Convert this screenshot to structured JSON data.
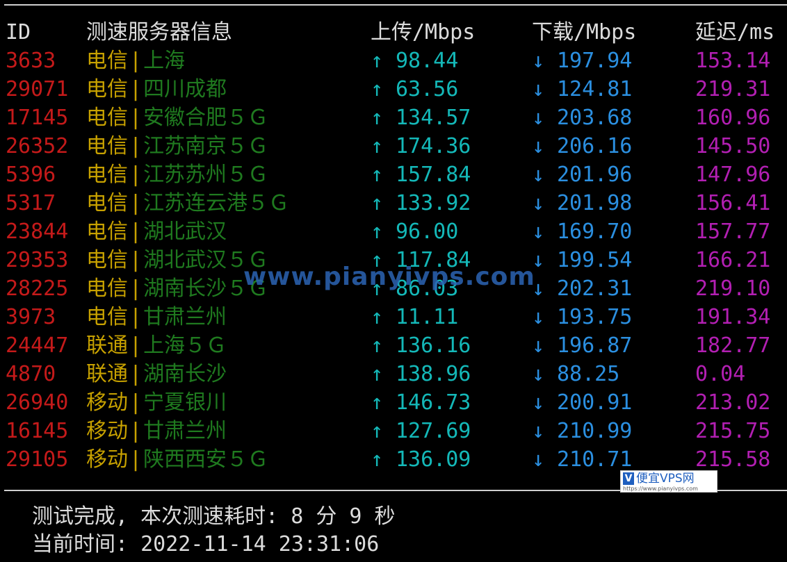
{
  "header": {
    "id": "ID",
    "node": "测速服务器信息",
    "upload": "上传/Mbps",
    "download": "下载/Mbps",
    "latency": "延迟/ms"
  },
  "symbols": {
    "up_arrow": "↑",
    "down_arrow": "↓",
    "separator": "|"
  },
  "rows": [
    {
      "id": "3633",
      "isp": "电信",
      "city": "上海",
      "up": "98.44",
      "down": "197.94",
      "latency": "153.14"
    },
    {
      "id": "29071",
      "isp": "电信",
      "city": "四川成都",
      "up": "63.56",
      "down": "124.81",
      "latency": "219.31"
    },
    {
      "id": "17145",
      "isp": "电信",
      "city": "安徽合肥５Ｇ",
      "up": "134.57",
      "down": "203.68",
      "latency": "160.96"
    },
    {
      "id": "26352",
      "isp": "电信",
      "city": "江苏南京５Ｇ",
      "up": "174.36",
      "down": "206.16",
      "latency": "145.50"
    },
    {
      "id": "5396",
      "isp": "电信",
      "city": "江苏苏州５Ｇ",
      "up": "157.84",
      "down": "201.96",
      "latency": "147.96"
    },
    {
      "id": "5317",
      "isp": "电信",
      "city": "江苏连云港５Ｇ",
      "up": "133.92",
      "down": "201.98",
      "latency": "156.41"
    },
    {
      "id": "23844",
      "isp": "电信",
      "city": "湖北武汉",
      "up": "96.00",
      "down": "169.70",
      "latency": "157.77"
    },
    {
      "id": "29353",
      "isp": "电信",
      "city": "湖北武汉５Ｇ",
      "up": "117.84",
      "down": "199.54",
      "latency": "166.21"
    },
    {
      "id": "28225",
      "isp": "电信",
      "city": "湖南长沙５Ｇ",
      "up": "86.03",
      "down": "202.31",
      "latency": "219.10"
    },
    {
      "id": "3973",
      "isp": "电信",
      "city": "甘肃兰州",
      "up": "11.11",
      "down": "193.75",
      "latency": "191.34"
    },
    {
      "id": "24447",
      "isp": "联通",
      "city": "上海５Ｇ",
      "up": "136.16",
      "down": "196.87",
      "latency": "182.77"
    },
    {
      "id": "4870",
      "isp": "联通",
      "city": "湖南长沙",
      "up": "138.96",
      "down": "88.25",
      "latency": "0.04"
    },
    {
      "id": "26940",
      "isp": "移动",
      "city": "宁夏银川",
      "up": "146.73",
      "down": "200.91",
      "latency": "213.02"
    },
    {
      "id": "16145",
      "isp": "移动",
      "city": "甘肃兰州",
      "up": "127.69",
      "down": "210.99",
      "latency": "215.75"
    },
    {
      "id": "29105",
      "isp": "移动",
      "city": "陕西西安５Ｇ",
      "up": "136.09",
      "down": "210.71",
      "latency": "215.58"
    }
  ],
  "footer": {
    "completed": "测试完成, 本次测速耗时: 8 分 9 秒",
    "current_time": "当前时间: 2022-11-14 23:31:06"
  },
  "watermark": {
    "text": "www.pianyivps.com"
  },
  "logo": {
    "mark": "V",
    "name": "便宜VPS网",
    "url": "https://www.pianyivps.com"
  }
}
